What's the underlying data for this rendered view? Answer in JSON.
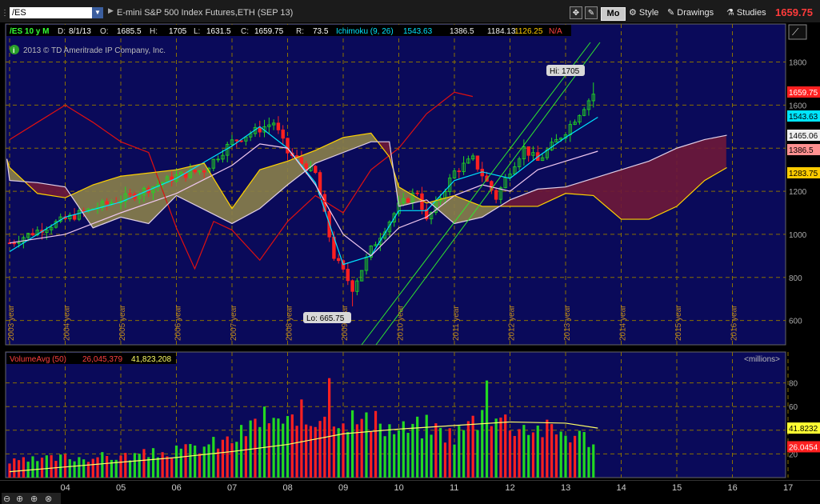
{
  "toolbar": {
    "symbol": "/ES",
    "contract": "E-mini S&P 500 Index Futures,ETH (SEP 13)",
    "mo": "Mo",
    "style": "Style",
    "drawings": "Drawings",
    "studies": "Studies",
    "last_price": "1659.75"
  },
  "info_bar": {
    "symbol": "/ES 10 y M",
    "d_label": "D:",
    "date": "8/1/13",
    "o_label": "O:",
    "open": "1685.5",
    "h_label": "H:",
    "high": "1705",
    "l_label": "L:",
    "low": "1631.5",
    "c_label": "C:",
    "close": "1659.75",
    "r_label": "R:",
    "range": "73.5",
    "ichimoku": "Ichimoku (9, 26)",
    "ich_values": [
      "1543.63",
      "1386.5",
      "1184.13",
      "1126.25",
      "N/A"
    ],
    "copyright": "2013 © TD Ameritrade IP Company, Inc.",
    "hi_label": "Hi: 1705",
    "lo_label": "Lo: 665.75"
  },
  "price_badges": [
    {
      "text": "1659.75",
      "bg": "#ff2020",
      "fg": "#fff"
    },
    {
      "text": "1543.63",
      "bg": "#00e5ff",
      "fg": "#000"
    },
    {
      "text": "1465.06",
      "bg": "#f0f0f0",
      "fg": "#000"
    },
    {
      "text": "1386.5",
      "bg": "#ff9090",
      "fg": "#000"
    },
    {
      "text": "1283.75",
      "bg": "#ffcc00",
      "fg": "#000"
    }
  ],
  "volume_info": {
    "label": "VolumeAvg (50)",
    "value1": "26,045,379",
    "value2": "41,823,208",
    "units": "<millions>",
    "badge_avg": "41.8232",
    "badge_vol": "26.0454"
  },
  "chart_data": [
    {
      "type": "candlestick",
      "title": "/ES 10 y M",
      "ylim": [
        500,
        1850
      ],
      "yticks": [
        600,
        800,
        1000,
        1200,
        1400,
        1600,
        1800
      ],
      "xticks": [
        "2003 year",
        "2004 year",
        "2005 year",
        "2006 year",
        "2007 year",
        "2008 year",
        "2009 year",
        "2010 year",
        "2011 year",
        "2012 year",
        "2013 year",
        "2014 year",
        "2015 year",
        "2016 year"
      ],
      "high": 1705,
      "low": 665.75,
      "anchors": [
        {
          "t": 2003.0,
          "p": 960
        },
        {
          "t": 2003.7,
          "p": 1040
        },
        {
          "t": 2004.5,
          "p": 1120
        },
        {
          "t": 2005.2,
          "p": 1180
        },
        {
          "t": 2006.0,
          "p": 1270
        },
        {
          "t": 2006.5,
          "p": 1300
        },
        {
          "t": 2007.0,
          "p": 1430
        },
        {
          "t": 2007.75,
          "p": 1520
        },
        {
          "t": 2008.0,
          "p": 1380
        },
        {
          "t": 2008.5,
          "p": 1280
        },
        {
          "t": 2008.83,
          "p": 900
        },
        {
          "t": 2009.17,
          "p": 750
        },
        {
          "t": 2009.5,
          "p": 930
        },
        {
          "t": 2010.0,
          "p": 1130
        },
        {
          "t": 2010.33,
          "p": 1200
        },
        {
          "t": 2010.5,
          "p": 1060
        },
        {
          "t": 2011.0,
          "p": 1290
        },
        {
          "t": 2011.33,
          "p": 1350
        },
        {
          "t": 2011.75,
          "p": 1170
        },
        {
          "t": 2012.0,
          "p": 1300
        },
        {
          "t": 2012.25,
          "p": 1400
        },
        {
          "t": 2012.5,
          "p": 1340
        },
        {
          "t": 2013.0,
          "p": 1480
        },
        {
          "t": 2013.58,
          "p": 1680
        }
      ],
      "series": [
        {
          "name": "Tenkan",
          "color": "#00e5ff",
          "points": [
            [
              2003.0,
              920
            ],
            [
              2004,
              1080
            ],
            [
              2005,
              1150
            ],
            [
              2006,
              1260
            ],
            [
              2007,
              1410
            ],
            [
              2007.5,
              1500
            ],
            [
              2008,
              1400
            ],
            [
              2008.5,
              1240
            ],
            [
              2009,
              860
            ],
            [
              2009.5,
              900
            ],
            [
              2010,
              1110
            ],
            [
              2010.5,
              1110
            ],
            [
              2011,
              1250
            ],
            [
              2011.5,
              1290
            ],
            [
              2012,
              1260
            ],
            [
              2012.5,
              1360
            ],
            [
              2013,
              1450
            ],
            [
              2013.58,
              1544
            ]
          ]
        },
        {
          "name": "Kijun",
          "color": "#f0c8f0",
          "points": [
            [
              2003.0,
              960
            ],
            [
              2004,
              1000
            ],
            [
              2005,
              1100
            ],
            [
              2006,
              1190
            ],
            [
              2007,
              1320
            ],
            [
              2007.5,
              1420
            ],
            [
              2008,
              1400
            ],
            [
              2008.5,
              1230
            ],
            [
              2009,
              1000
            ],
            [
              2009.5,
              900
            ],
            [
              2010,
              1030
            ],
            [
              2010.5,
              1080
            ],
            [
              2011,
              1180
            ],
            [
              2011.5,
              1230
            ],
            [
              2012,
              1200
            ],
            [
              2012.5,
              1300
            ],
            [
              2013,
              1340
            ],
            [
              2013.58,
              1386
            ]
          ]
        },
        {
          "name": "Chikou",
          "color": "#e01010",
          "points": [
            [
              2003.0,
              1440
            ],
            [
              2003.5,
              1520
            ],
            [
              2004,
              1600
            ],
            [
              2004.5,
              1520
            ],
            [
              2005,
              1430
            ],
            [
              2005.5,
              1380
            ],
            [
              2006,
              1030
            ],
            [
              2006.33,
              840
            ],
            [
              2006.67,
              1060
            ],
            [
              2007,
              1020
            ],
            [
              2007.5,
              880
            ],
            [
              2008,
              1060
            ],
            [
              2008.5,
              1180
            ],
            [
              2009,
              1100
            ],
            [
              2009.5,
              1300
            ],
            [
              2010,
              1400
            ],
            [
              2010.5,
              1560
            ],
            [
              2011,
              1660
            ],
            [
              2011.33,
              1640
            ]
          ]
        },
        {
          "name": "Senkou A",
          "color": "#ffd300",
          "points": [
            [
              2002.95,
              1350
            ],
            [
              2003,
              1310
            ],
            [
              2003.5,
              1190
            ],
            [
              2004,
              1170
            ],
            [
              2004.5,
              1230
            ],
            [
              2005,
              1270
            ],
            [
              2006,
              1300
            ],
            [
              2006.5,
              1330
            ],
            [
              2007,
              1120
            ],
            [
              2007.5,
              1300
            ],
            [
              2008,
              1340
            ],
            [
              2008.5,
              1390
            ],
            [
              2009,
              1450
            ],
            [
              2009.5,
              1470
            ],
            [
              2009.83,
              1360
            ],
            [
              2010,
              1220
            ],
            [
              2010.5,
              1145
            ],
            [
              2011,
              1180
            ],
            [
              2011.5,
              1130
            ],
            [
              2012,
              1130
            ],
            [
              2012.5,
              1130
            ],
            [
              2013,
              1190
            ],
            [
              2013.5,
              1180
            ],
            [
              2014,
              1070
            ],
            [
              2014.5,
              1070
            ],
            [
              2015,
              1130
            ],
            [
              2015.5,
              1250
            ],
            [
              2015.9,
              1310
            ]
          ]
        },
        {
          "name": "Senkou B",
          "color": "#e0d0e8",
          "points": [
            [
              2002.95,
              1350
            ],
            [
              2003,
              1250
            ],
            [
              2003.5,
              1240
            ],
            [
              2004,
              1220
            ],
            [
              2004.5,
              1030
            ],
            [
              2005,
              1080
            ],
            [
              2005.5,
              1050
            ],
            [
              2006,
              1180
            ],
            [
              2007,
              1050
            ],
            [
              2007.5,
              1120
            ],
            [
              2008,
              1230
            ],
            [
              2008.5,
              1330
            ],
            [
              2009,
              1380
            ],
            [
              2009.5,
              1430
            ],
            [
              2009.83,
              1430
            ],
            [
              2010,
              1130
            ],
            [
              2010.5,
              1160
            ],
            [
              2011,
              1050
            ],
            [
              2011.5,
              1080
            ],
            [
              2012,
              1160
            ],
            [
              2012.5,
              1210
            ],
            [
              2013,
              1220
            ],
            [
              2013.5,
              1260
            ],
            [
              2014,
              1300
            ],
            [
              2014.5,
              1340
            ],
            [
              2015,
              1400
            ],
            [
              2015.5,
              1440
            ],
            [
              2015.9,
              1460
            ]
          ]
        }
      ]
    },
    {
      "type": "bar",
      "title": "VolumeAvg (50)",
      "ylabel": "<millions>",
      "ylim": [
        0,
        90
      ],
      "yticks": [
        20,
        40,
        60,
        80
      ],
      "xticks": [
        "04",
        "05",
        "06",
        "07",
        "08",
        "09",
        "10",
        "11",
        "12",
        "13",
        "14",
        "15",
        "16",
        "17"
      ],
      "volume_anchors": [
        {
          "t": 2003.0,
          "v": 13
        },
        {
          "t": 2004.0,
          "v": 17
        },
        {
          "t": 2005.0,
          "v": 18
        },
        {
          "t": 2006.0,
          "v": 22
        },
        {
          "t": 2007.0,
          "v": 32
        },
        {
          "t": 2007.5,
          "v": 48
        },
        {
          "t": 2008.0,
          "v": 42
        },
        {
          "t": 2008.75,
          "v": 60
        },
        {
          "t": 2009.0,
          "v": 52
        },
        {
          "t": 2010.0,
          "v": 40
        },
        {
          "t": 2010.5,
          "v": 44
        },
        {
          "t": 2011.0,
          "v": 36
        },
        {
          "t": 2011.6,
          "v": 58
        },
        {
          "t": 2012.0,
          "v": 46
        },
        {
          "t": 2013.0,
          "v": 38
        },
        {
          "t": 2013.58,
          "v": 32
        }
      ],
      "spikes": [
        {
          "t": 2008.75,
          "v": 84
        },
        {
          "t": 2011.62,
          "v": 82
        },
        {
          "t": 2008.25,
          "v": 66
        },
        {
          "t": 2007.58,
          "v": 60
        }
      ],
      "avg": [
        [
          2003.0,
          5
        ],
        [
          2004,
          9
        ],
        [
          2005,
          13
        ],
        [
          2006,
          17
        ],
        [
          2007,
          22
        ],
        [
          2008,
          28
        ],
        [
          2009,
          37
        ],
        [
          2010,
          41
        ],
        [
          2011,
          44
        ],
        [
          2012,
          47
        ],
        [
          2013,
          46
        ],
        [
          2013.58,
          41.8
        ]
      ],
      "last_volume": 26.0454,
      "last_avg": 41.8232
    }
  ]
}
